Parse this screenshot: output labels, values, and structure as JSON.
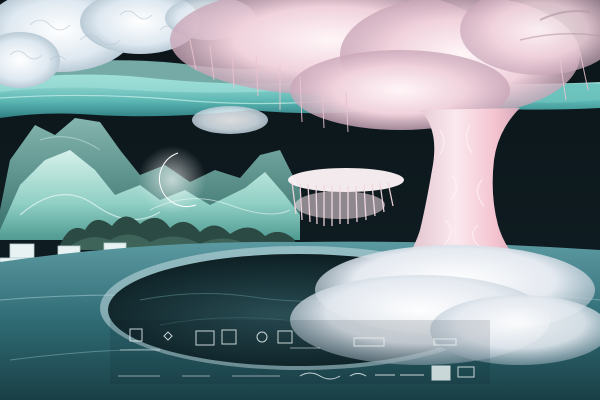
{
  "scene": {
    "palette": {
      "sky_dark": "#081014",
      "drape_teal": "#7fd0cc",
      "cloud_white": "#eef4f8",
      "mountain_mint": "#a9dcd3",
      "tree_pink": "#f1c6d0",
      "tree_white": "#fbf3f6",
      "floor_teal": "#2e6d76",
      "water_dark": "#0f2226"
    },
    "elements": [
      "ceiling-flower-cloud",
      "teal-drapery-band",
      "paper-mountain-backdrop",
      "crescent-moon-sculpture",
      "floating-feather-canopy",
      "pampas-feather-tree",
      "silver-runway-floor",
      "circular-reflecting-pool",
      "white-cube-stools",
      "hedge-planting"
    ]
  },
  "sponsor_logos": {
    "row1": [
      "",
      "",
      "",
      "",
      "",
      "",
      ""
    ],
    "row2": [
      "",
      "",
      "",
      "",
      "",
      "",
      "",
      ""
    ]
  }
}
